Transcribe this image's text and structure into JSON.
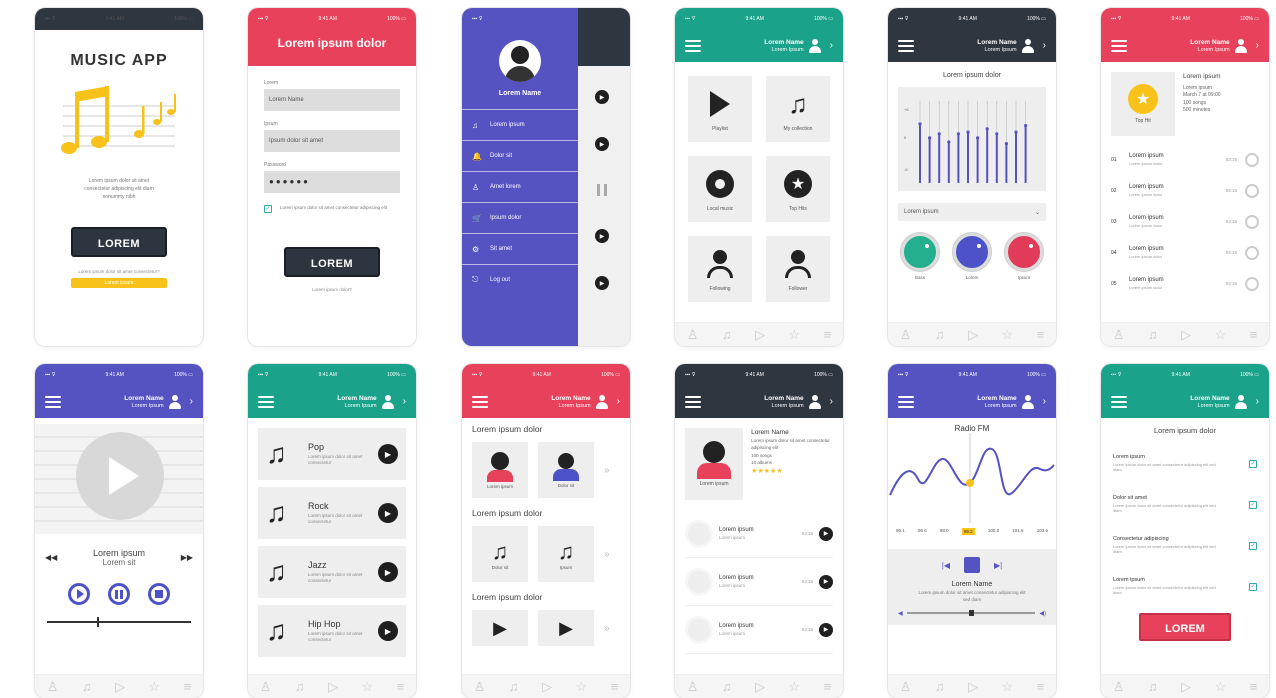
{
  "colors": {
    "red": "#e8415b",
    "teal": "#1aa38a",
    "purple": "#5552c2",
    "dark": "#2e3640",
    "yellow": "#f8c21a",
    "green": "#24b08e",
    "indigo": "#4d52c9",
    "pink": "#e23b59"
  },
  "status": {
    "carrier": "▪▪▪ ⊽",
    "time": "9:41 AM",
    "battery": "100% ▭"
  },
  "header_user": {
    "name": "Lorem Name",
    "sub": "Lorem Ipsum"
  },
  "tabs": [
    "♙",
    "♫",
    "▷",
    "☆",
    "≡"
  ],
  "s1": {
    "title": "MUSIC APP",
    "body": "Lorem ipsum dolor sit amet consectetur adipiscing elit diam nonummy nibh",
    "button": "LOREM",
    "link": "Lorem ipsum dolor sit amet consectetur?",
    "cta": "Lorem ipsum"
  },
  "s2": {
    "header": "Lorem ipsum dolor",
    "label1": "Lorem",
    "value1": "Lorem Name",
    "label2": "Ipsum",
    "value2": "Ipsum dolor sit amet",
    "label3": "Password",
    "value3": "●●●●●●",
    "remember": "Lorem ipsum dolor sit amet consectetur adipiscing elit",
    "button": "LOREM",
    "forgot": "Lorem ipsum dolor?"
  },
  "s3": {
    "name": "Lorem Name",
    "menu": [
      "Lorem ipsum",
      "Dolor sit",
      "Amet lorem",
      "Ipsum dolor",
      "Sit amet",
      "Log out"
    ],
    "menu_icons": [
      "♫",
      "🔔",
      "♙",
      "🛒",
      "⚙",
      "⎋"
    ]
  },
  "s4": {
    "tiles": [
      "Playlist",
      "My collection",
      "Local music",
      "Top Hits",
      "Following",
      "Follower"
    ]
  },
  "s5": {
    "title": "Lorem ipsum dolor",
    "ylabels": [
      "+6",
      "0",
      "-6"
    ],
    "select": "Lorem ipsum",
    "knobs": [
      "Bass",
      "Lorem",
      "Ipsum"
    ]
  },
  "s6": {
    "badge": "Top Hit",
    "info_title": "Lorem ipsum",
    "info": [
      "Lorem ipsum",
      "March 7 at 09:00",
      "100 songs",
      "500 minutes"
    ],
    "tracks": [
      {
        "n": "01",
        "t": "Lorem ipsum",
        "s": "Lorem ipsum dolor",
        "d": "03:15"
      },
      {
        "n": "02",
        "t": "Lorem ipsum",
        "s": "Lorem ipsum dolor",
        "d": "03:15"
      },
      {
        "n": "03",
        "t": "Lorem ipsum",
        "s": "Lorem ipsum dolor",
        "d": "03:15"
      },
      {
        "n": "04",
        "t": "Lorem ipsum",
        "s": "Lorem ipsum dolor",
        "d": "03:15"
      },
      {
        "n": "05",
        "t": "Lorem ipsum",
        "s": "Lorem ipsum dolor",
        "d": "03:15"
      }
    ]
  },
  "s7": {
    "song": "Lorem ipsum",
    "artist": "Lorem sit",
    "rewind": "◀◀",
    "forward": "▶▶"
  },
  "s8": {
    "genres": [
      {
        "t": "Pop",
        "d": "Lorem ipsum dolor sit amet consectetur"
      },
      {
        "t": "Rock",
        "d": "Lorem ipsum dolor sit amet consectetur"
      },
      {
        "t": "Jazz",
        "d": "Lorem ipsum dolor sit amet consectetur"
      },
      {
        "t": "Hip Hop",
        "d": "Lorem ipsum dolor sit amet consectetur"
      }
    ]
  },
  "s9": {
    "sections": [
      "Lorem ipsum dolor",
      "Lorem ipsum dolor",
      "Lorem ipsum dolor"
    ],
    "artists": [
      "Lorem ipsum",
      "Dolor sit"
    ],
    "albums": [
      "Dolor sit",
      "Ipsum"
    ],
    "more": "»"
  },
  "s10": {
    "artist_label": "Lorem ipsum",
    "title": "Lorem Name",
    "desc": "Lorem ipsum dolor sit amet consectetur adipiscing elit",
    "songs": "100 songs",
    "albums": "10 albums",
    "stars": "★★★★★",
    "items": [
      {
        "t": "Lorem ipsum",
        "s": "Lorem ipsum",
        "d": "03:15"
      },
      {
        "t": "Lorem ipsum",
        "s": "Lorem ipsum",
        "d": "03:15"
      },
      {
        "t": "Lorem ipsum",
        "s": "Lorem ipsum",
        "d": "03:15"
      }
    ]
  },
  "s11": {
    "title": "Radio FM",
    "freqs": [
      "96.1",
      "96.6",
      "98.0",
      "99.2",
      "100.0",
      "101.5",
      "103.6"
    ],
    "selected": "99.2",
    "name": "Lorem Name",
    "desc": "Lorem ipsum dolor sit amet consectetur adipiscing elit sed diam"
  },
  "s12": {
    "title": "Lorem ipsum dolor",
    "items": [
      {
        "t": "Lorem ipsum",
        "d": "Lorem ipsum dolor sit amet consectetur adipiscing elit sed diam"
      },
      {
        "t": "Dolor sit amet",
        "d": "Lorem ipsum dolor sit amet consectetur adipiscing elit sed diam"
      },
      {
        "t": "Consectetur adipiscing",
        "d": "Lorem ipsum dolor sit amet consectetur adipiscing elit sed diam"
      },
      {
        "t": "Lorem ipsum",
        "d": "Lorem ipsum dolor sit amet consectetur adipiscing elit sed diam"
      }
    ],
    "button": "LOREM"
  }
}
